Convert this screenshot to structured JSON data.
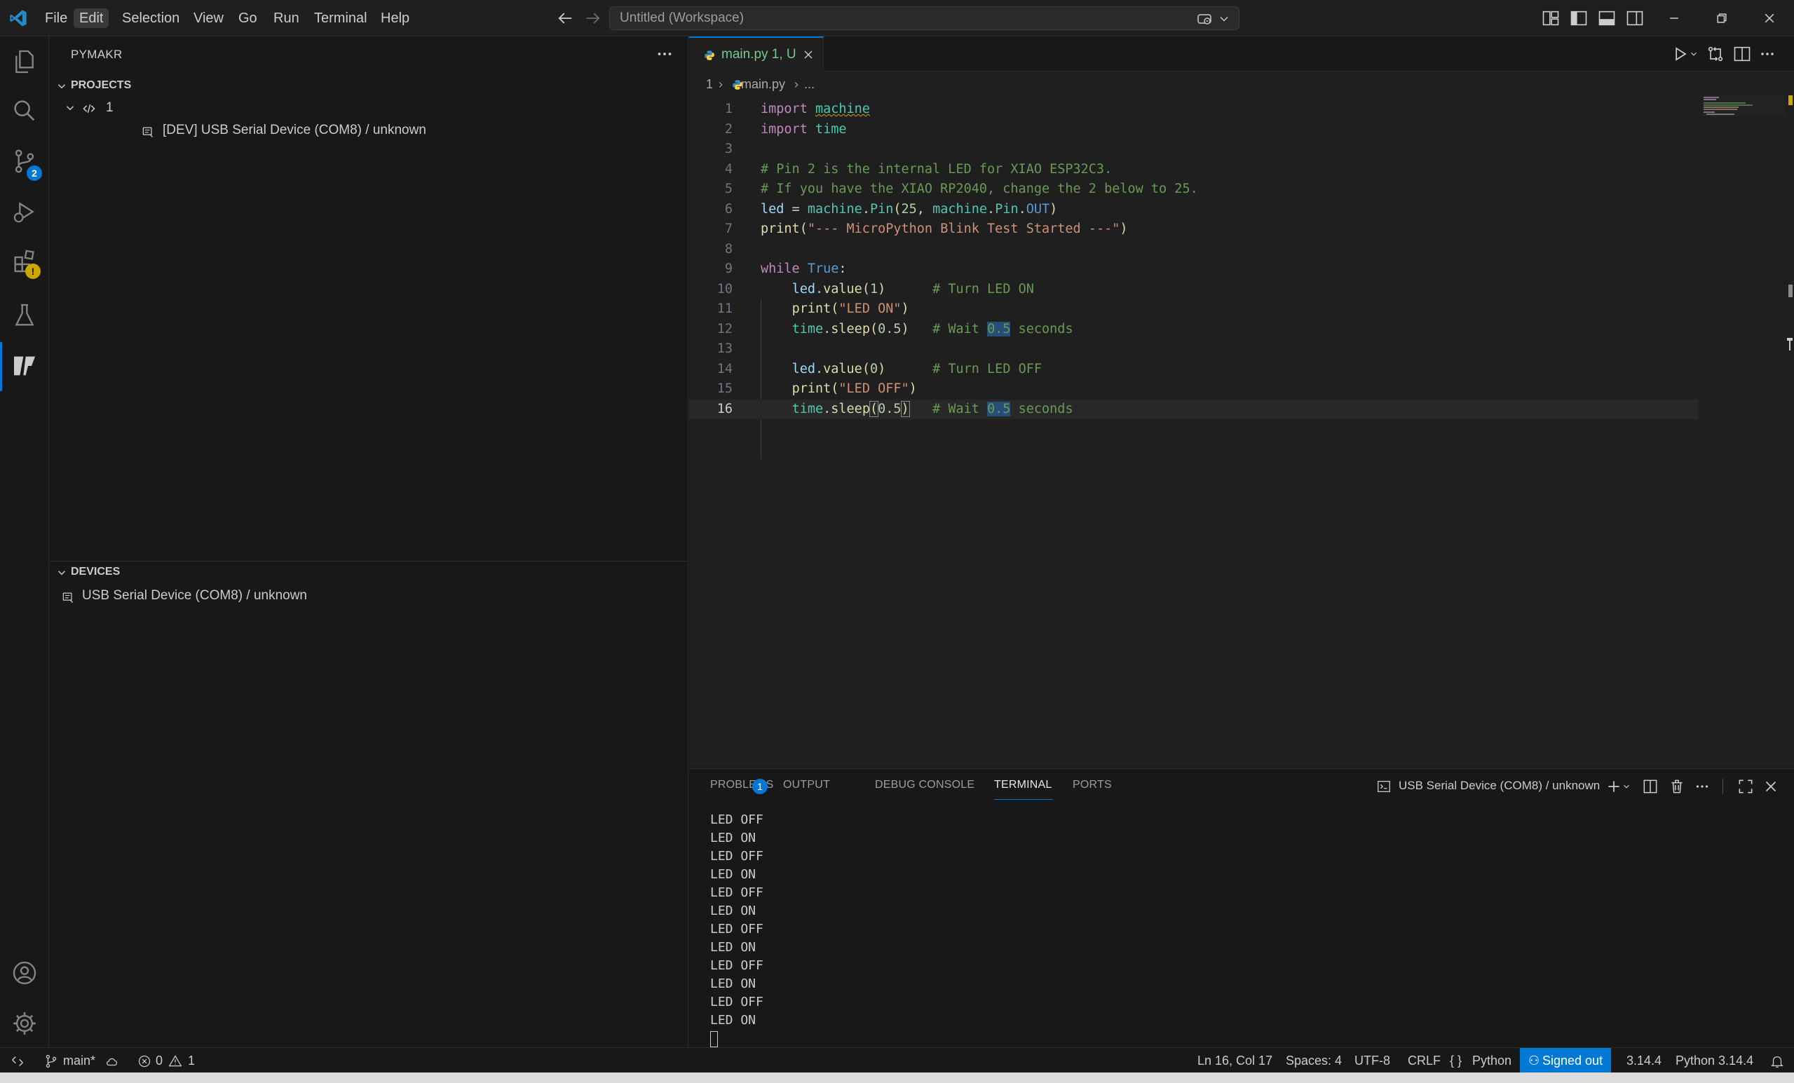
{
  "menu": {
    "items": [
      "File",
      "Edit",
      "Selection",
      "View",
      "Go",
      "Run",
      "Terminal",
      "Help"
    ],
    "active": "Edit"
  },
  "command_center": {
    "title": "Untitled (Workspace)"
  },
  "activity_bar": {
    "source_control_badge": "2",
    "extensions_badge": "!"
  },
  "sidebar": {
    "title": "PYMAKR",
    "projects_header": "PROJECTS",
    "project_name": "1",
    "project_device": "[DEV] USB Serial Device (COM8) / unknown",
    "devices_header": "DEVICES",
    "device": "USB Serial Device (COM8) / unknown"
  },
  "editor": {
    "tab_label": "main.py 1, U",
    "breadcrumb": {
      "folder": "1",
      "file": "main.py",
      "rest": "..."
    },
    "line_numbers": [
      "1",
      "2",
      "3",
      "4",
      "5",
      "6",
      "7",
      "8",
      "9",
      "10",
      "11",
      "12",
      "13",
      "14",
      "15",
      "16"
    ],
    "current_line": 16,
    "code": {
      "l1_kw": "import",
      "l1_mod": "machine",
      "l2_kw": "import",
      "l2_mod": "time",
      "l4": "# Pin 2 is the internal LED for XIAO ESP32C3.",
      "l5": "# If you have the XIAO RP2040, change the 2 below to 25.",
      "l6_var": "led",
      "l6_eq": " = ",
      "l6_mod": "machine",
      "l6_fn": "Pin",
      "l6_num": "25",
      "l6_mod2": "machine",
      "l6_attr": "Pin",
      "l6_const": "OUT",
      "l7_fn": "print",
      "l7_str": "\"--- MicroPython Blink Test Started ---\"",
      "l9_kw": "while",
      "l9_const": "True",
      "l10_var": "led",
      "l10_fn": "value",
      "l10_num": "1",
      "l10_cm": "# Turn LED ON",
      "l11_fn": "print",
      "l11_str": "\"LED ON\"",
      "l12_mod": "time",
      "l12_fn": "sleep",
      "l12_num": "0.5",
      "l12_cm1": "# Wait ",
      "l12_cm_num": "0.5",
      "l12_cm2": " seconds",
      "l14_var": "led",
      "l14_fn": "value",
      "l14_num": "0",
      "l14_cm": "# Turn LED OFF",
      "l15_fn": "print",
      "l15_str": "\"LED OFF\"",
      "l16_mod": "time",
      "l16_fn": "sleep",
      "l16_num": "0.5",
      "l16_cm1": "# Wait ",
      "l16_cm_num": "0.5",
      "l16_cm2": " seconds"
    }
  },
  "panel": {
    "tabs": [
      "PROBLEMS",
      "OUTPUT",
      "DEBUG CONSOLE",
      "TERMINAL",
      "PORTS"
    ],
    "active_tab": "TERMINAL",
    "problems_count": "1",
    "terminal_name": "USB Serial Device (COM8) / unknown",
    "terminal_lines": [
      "LED OFF",
      "LED ON",
      "LED OFF",
      "LED ON",
      "LED OFF",
      "LED ON",
      "LED OFF",
      "LED ON",
      "LED OFF",
      "LED ON",
      "LED OFF",
      "LED ON"
    ]
  },
  "status_bar": {
    "branch": "main*",
    "errors": "0",
    "warnings": "1",
    "cursor_position": "Ln 16, Col 17",
    "spaces": "Spaces: 4",
    "encoding": "UTF-8",
    "eol": "CRLF",
    "language": "Python",
    "signed_out": "Signed out",
    "version": "3.14.4",
    "interpreter": "Python 3.14.4"
  },
  "colors": {
    "accent": "#0078d4",
    "editor_bg": "#1f1f1f",
    "sidebar_bg": "#181818",
    "modified_file": "#73c991",
    "warning": "#cca700"
  }
}
